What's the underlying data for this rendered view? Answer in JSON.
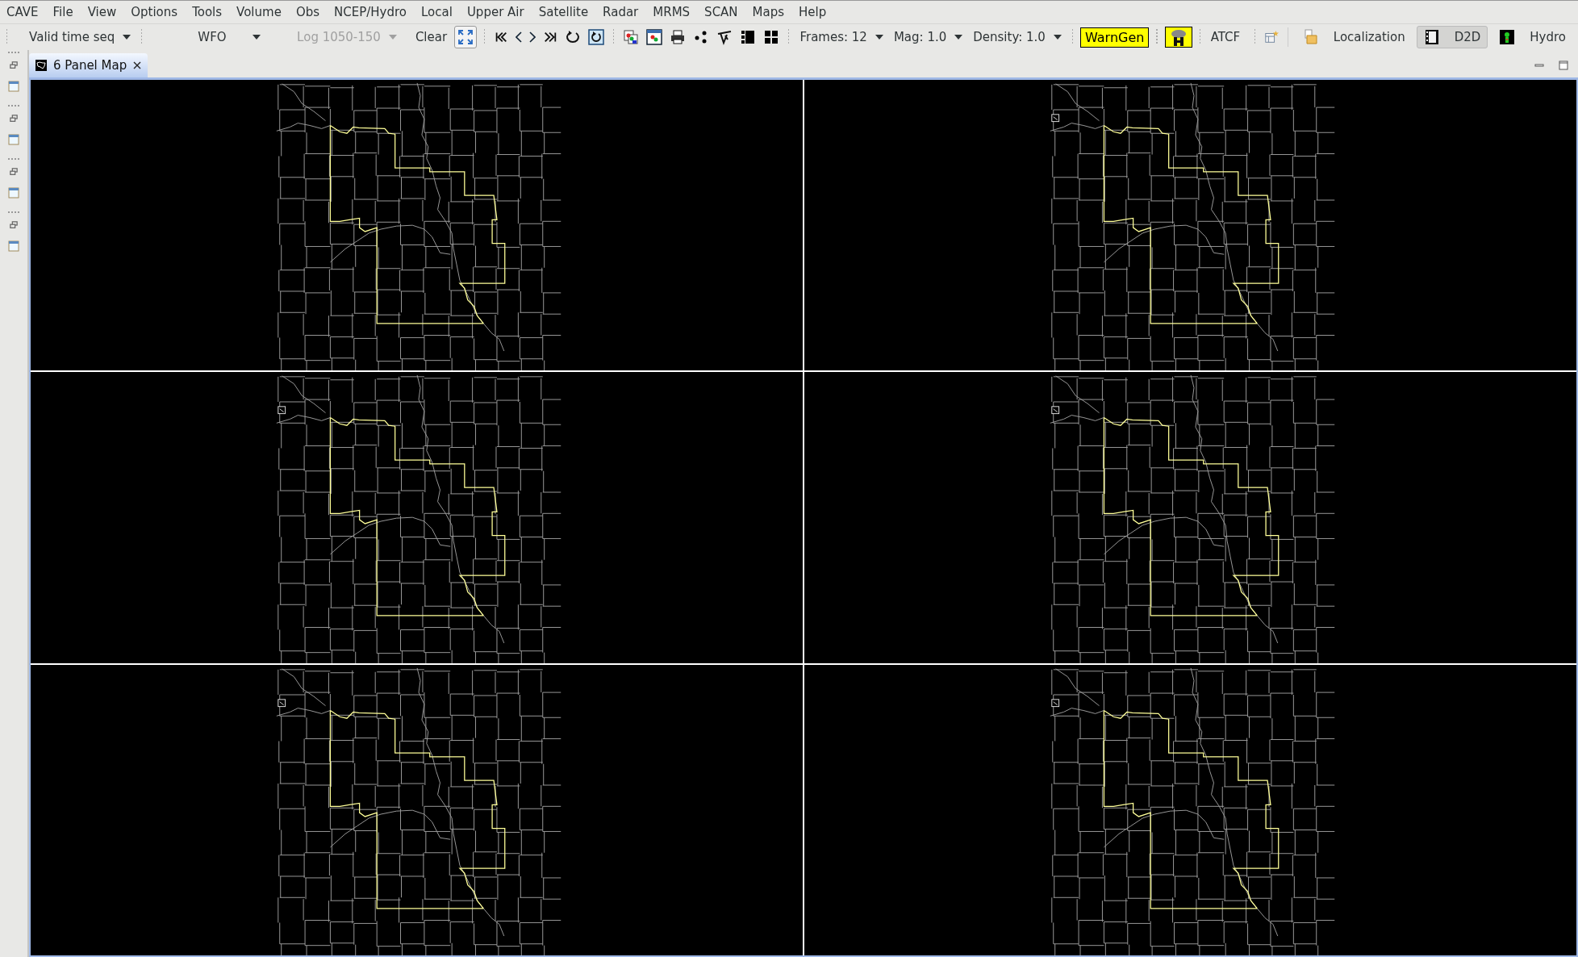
{
  "menu_bar": {
    "items": [
      "CAVE",
      "File",
      "View",
      "Options",
      "Tools",
      "Volume",
      "Obs",
      "NCEP/Hydro",
      "Local",
      "Upper Air",
      "Satellite",
      "Radar",
      "MRMS",
      "SCAN",
      "Maps",
      "Help"
    ]
  },
  "toolbar": {
    "time_mode": {
      "value": "Valid time seq",
      "disabled": false
    },
    "scale": {
      "value": "WFO",
      "disabled": false
    },
    "pressure": {
      "value": "Log 1050-150",
      "disabled": true
    },
    "clear_button": "Clear",
    "frames": "Frames: 12",
    "magnification": "Mag: 1.0",
    "density": "Density: 1.0",
    "warngen_button": "WarnGen",
    "atcf_button": "ATCF"
  },
  "perspectives": [
    {
      "label": "Localization",
      "selected": false
    },
    {
      "label": "D2D",
      "selected": true
    },
    {
      "label": "Hydro",
      "selected": false
    }
  ],
  "editor_tab": {
    "title": "6 Panel Map",
    "selected": true
  },
  "panels": [
    {
      "marker": false
    },
    {
      "marker": true
    },
    {
      "marker": true
    },
    {
      "marker": true
    },
    {
      "marker": true
    },
    {
      "marker": true
    }
  ]
}
